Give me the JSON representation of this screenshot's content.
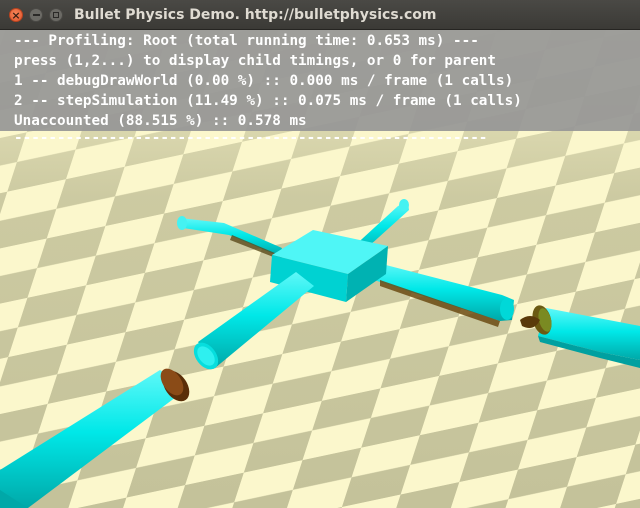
{
  "window": {
    "title": "Bullet Physics Demo. http://bulletphysics.com",
    "close_icon": "close-icon",
    "minimize_icon": "minimize-icon",
    "maximize_icon": "maximize-icon"
  },
  "profiler": {
    "lines": [
      "--- Profiling: Root (total running time: 0.653 ms) ---",
      "press (1,2...) to display child timings, or 0 for parent",
      "1 -- debugDrawWorld (0.00 %) :: 0.000 ms / frame (1 calls)",
      "2 -- stepSimulation (11.49 %) :: 0.075 ms / frame (1 calls)",
      "Unaccounted (88.515 %) :: 0.578 ms"
    ],
    "separator": "-------------------------------------------------------"
  },
  "scene": {
    "floor_light": "#fbf7cc",
    "floor_dark": "#b9b791",
    "object_color": "#00e5e5",
    "cap_color": "#8a4b17"
  }
}
